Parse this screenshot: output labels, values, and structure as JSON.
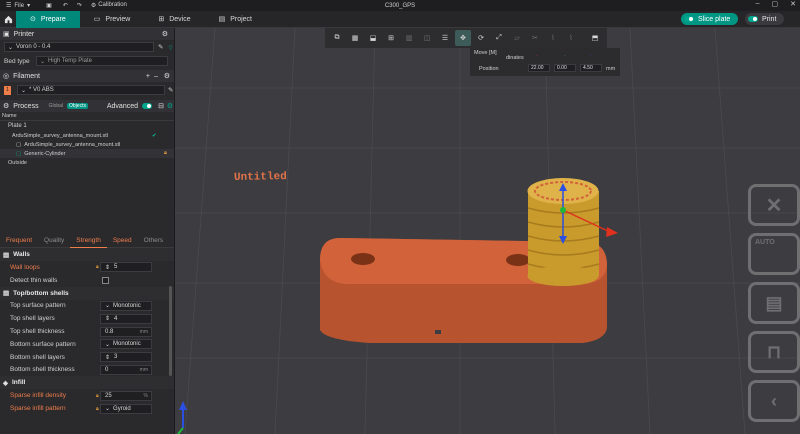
{
  "titlebar": {
    "file_label": "File",
    "calibration_label": "Calibration",
    "window_title": "C300_GPS"
  },
  "tabs": [
    {
      "label": "Prepare"
    },
    {
      "label": "Preview"
    },
    {
      "label": "Device"
    },
    {
      "label": "Project"
    }
  ],
  "actions": {
    "slice_label": "Slice plate",
    "print_label": "Print"
  },
  "printer": {
    "section_title": "Printer",
    "name": "Voron 0 - 0.4",
    "bed_type_label": "Bed type",
    "bed_type_value": "High Temp Plate"
  },
  "filament": {
    "section_title": "Filament",
    "slot": "1",
    "name": "* V0 ABS",
    "slot_color": "#ef7d4a"
  },
  "process": {
    "section_title": "Process",
    "global_label": "Global",
    "objects_label": "Objects",
    "advanced_label": "Advanced"
  },
  "objects": {
    "column_name": "Name",
    "items": [
      {
        "label": "Plate 1"
      },
      {
        "label": "ArduSimple_survey_antenna_mount.stl"
      },
      {
        "label": "ArduSimple_survey_antenna_mount.stl"
      },
      {
        "label": "Generic-Cylinder"
      },
      {
        "label": "Outside"
      }
    ]
  },
  "param_tabs": [
    {
      "label": "Frequent"
    },
    {
      "label": "Quality"
    },
    {
      "label": "Strength"
    },
    {
      "label": "Speed"
    },
    {
      "label": "Others"
    }
  ],
  "params": {
    "walls_title": "Walls",
    "wall_loops_label": "Wall loops",
    "wall_loops_value": "5",
    "detect_thin_walls_label": "Detect thin walls",
    "shells_title": "Top/bottom shells",
    "top_surface_pattern_label": "Top surface pattern",
    "top_surface_pattern_value": "Monotonic",
    "top_shell_layers_label": "Top shell layers",
    "top_shell_layers_value": "4",
    "top_shell_thickness_label": "Top shell thickness",
    "top_shell_thickness_value": "0.8",
    "bottom_surface_pattern_label": "Bottom surface pattern",
    "bottom_surface_pattern_value": "Monotonic",
    "bottom_shell_layers_label": "Bottom shell layers",
    "bottom_shell_layers_value": "3",
    "bottom_shell_thickness_label": "Bottom shell thickness",
    "bottom_shell_thickness_value": "0",
    "infill_title": "Infill",
    "sparse_infill_density_label": "Sparse infill density",
    "sparse_infill_density_value": "25",
    "sparse_infill_pattern_label": "Sparse infill pattern",
    "sparse_infill_pattern_value": "Gyroid",
    "unit_mm": "mm",
    "unit_pct": "%"
  },
  "move_panel": {
    "title": "Move [M]",
    "coords_label": "dinates",
    "position_label": "Position",
    "x": "22.00",
    "y": "0.00",
    "z": "4.50",
    "unit": "mm"
  },
  "viewport": {
    "plate_label": "Untitled",
    "right_icon_auto": "AUTO"
  },
  "colors": {
    "accent": "#009684",
    "model": "#d2623a",
    "cylinder": "#d9a838"
  }
}
